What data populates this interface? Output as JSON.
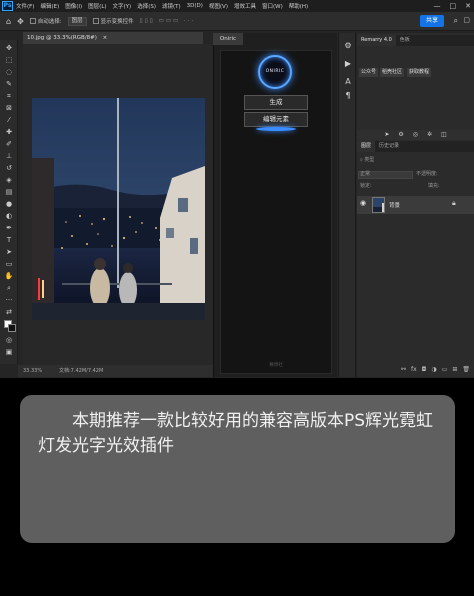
{
  "menubar": {
    "logo": "Ps",
    "items": [
      "文件(F)",
      "编辑(E)",
      "图像(I)",
      "图层(L)",
      "文字(Y)",
      "选择(S)",
      "滤镜(T)",
      "3D(D)",
      "视图(V)",
      "增效工具",
      "窗口(W)",
      "帮助(H)"
    ],
    "window_controls": [
      "—",
      "□",
      "✕"
    ]
  },
  "options": {
    "auto_select_label": "自动选择:",
    "layer_select": "图层",
    "transform_label": "显示变换控件",
    "share_label": "共享"
  },
  "document": {
    "tab_title": "10.jpg @ 33.3%(RGB/8#)",
    "zoom": "33.33%",
    "doc_info": "文档:7.42M/7.42M"
  },
  "plugin": {
    "tab": "Oniric",
    "logo_text": "ONIRIC",
    "buttons": [
      "生成",
      "编辑元素"
    ],
    "footer": "赛博社"
  },
  "panels": {
    "top_tabs": [
      "Remarry 4.0",
      "色板"
    ],
    "sub_buttons": [
      "公众号",
      "稻壳社区",
      "获取教程"
    ],
    "layers_tabs": [
      "图层",
      "历史记录"
    ],
    "kind_label": "类型",
    "blend_mode": "正常",
    "opacity_label": "不透明度:",
    "lock_label": "锁定:",
    "fill_label": "填充:",
    "layer_name": "背景"
  },
  "caption": {
    "text": "本期推荐一款比较好用的兼容高版本PS辉光霓虹灯发光字光效插件"
  },
  "colors": {
    "accent_blue": "#1473e6",
    "glow_blue": "#3b8cff",
    "caption_bg": "#5f5f5f"
  }
}
